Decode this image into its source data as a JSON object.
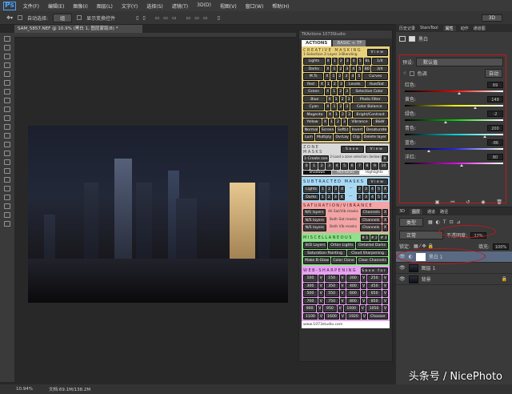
{
  "app": {
    "logo": "Ps",
    "menu": [
      "文件(F)",
      "编辑(E)",
      "图像(I)",
      "图层(L)",
      "文字(Y)",
      "选择(S)",
      "滤镜(T)",
      "3D(D)",
      "视图(V)",
      "窗口(W)",
      "帮助(H)"
    ]
  },
  "options": {
    "auto_select": "自动选择:",
    "auto_select_value": "组",
    "show_transform": "显示变换控件",
    "mode3d": "3D"
  },
  "document": {
    "tab": "SAM_5857.NEF @ 10.9% (黑白 1, 图层蒙版/8) *",
    "zoom": "10.94%",
    "doc_size": "文档:69.1M/138.2M"
  },
  "tk": {
    "title": "TKActions 1073Studio",
    "tabs": [
      "ACTIONS",
      "BASIC + TF"
    ],
    "creative": {
      "title": "CREATIVE MASKING",
      "subtitle": "1-Selection 2-Layer 3-Blending",
      "view": "View",
      "rows": [
        [
          "Lights",
          "X",
          "1",
          "2",
          "3",
          "4",
          "5",
          "BL",
          "1/4"
        ],
        [
          "Darks",
          "X",
          "1",
          "2",
          "3",
          "4",
          "5",
          "BD",
          "3/4"
        ],
        [
          "M.Ts",
          "X",
          "1",
          "2",
          "3",
          "4",
          "5",
          "Curves"
        ],
        [
          "Red",
          "X",
          "1",
          "2",
          "3",
          "Levels",
          "Hue/Sat"
        ],
        [
          "Green",
          "X",
          "1",
          "2",
          "3",
          "Selective Color"
        ],
        [
          "Blue",
          "X",
          "1",
          "2",
          "3",
          "Photo Filter"
        ],
        [
          "Cyan",
          "X",
          "1",
          "2",
          "3",
          "Color Balance"
        ],
        [
          "Magenta",
          "X",
          "1",
          "2",
          "3",
          "Bright/Contrast"
        ],
        [
          "Yellow",
          "X",
          "1",
          "2",
          "3",
          "Vibrance",
          "B&W"
        ],
        [
          "Normal",
          "Screen",
          "SoftLt",
          "Invert",
          "Desaturate"
        ],
        [
          "Lum",
          "Multiply",
          "OvrLay",
          "Clip",
          "Delete layer"
        ]
      ]
    },
    "zone": {
      "title": "ZONE MASKS",
      "save": "Save",
      "view": "View",
      "create": "1-Create zone masks",
      "load": "2-Load a zone selection (below)",
      "x": "X",
      "zones": [
        "0",
        "1",
        "2",
        "3",
        "4",
        "5",
        "6",
        "7",
        "8",
        "9",
        "10"
      ],
      "labels": [
        "Shadows",
        "Mid-tones",
        "Highlights"
      ]
    },
    "subtracted": {
      "title": "SUBTRACTED MASKS",
      "view": "View",
      "rows": [
        [
          "Lights",
          "1",
          "2",
          "3",
          "4",
          "—",
          "2",
          "3",
          "4",
          "5",
          "X"
        ],
        [
          "Darks",
          "1",
          "2",
          "3",
          "4",
          "—",
          "2",
          "3",
          "4",
          "5",
          "X"
        ]
      ]
    },
    "saturation": {
      "title": "SATURATION/VIBRANCE",
      "rows": [
        [
          "N/S layers",
          "All Sat/Vib masks",
          "Channels",
          "X"
        ],
        [
          "N/S layers",
          "Both Sat masks",
          "Channels",
          "X"
        ],
        [
          "N/S layers",
          "Both Vib masks",
          "Channels",
          "X"
        ]
      ]
    },
    "misc": {
      "title": "MISCELLANEOUS",
      "buttons": [
        "#1",
        "#2",
        "#3"
      ],
      "rows": [
        [
          "B/D Layers",
          "Orton Lights",
          "Detailed Darks"
        ],
        [
          "Saturation Painting",
          "Cloud Sharpening"
        ],
        [
          "Make B-Glow",
          "Color Clone",
          "Clear Channels"
        ]
      ]
    },
    "web": {
      "title": "WEB-SHARPENING",
      "save": "Save for Web",
      "rows": [
        [
          "100",
          "V",
          "150",
          "V",
          "200",
          "V",
          "250",
          "V"
        ],
        [
          "300",
          "V",
          "350",
          "V",
          "400",
          "V",
          "450",
          "V"
        ],
        [
          "500",
          "V",
          "550",
          "V",
          "600",
          "V",
          "650",
          "V"
        ],
        [
          "700",
          "V",
          "750",
          "V",
          "800",
          "V",
          "850",
          "V"
        ],
        [
          "900",
          "V",
          "950",
          "V",
          "1000",
          "V",
          "1050",
          "V"
        ],
        [
          "1100",
          "V",
          "1600",
          "V",
          "1920",
          "V",
          "Chooser"
        ]
      ]
    },
    "footer": "www.1073studio.com"
  },
  "properties": {
    "tabs": [
      "历史记录",
      "StarsTool",
      "属性",
      "动作",
      "通道图"
    ],
    "title": "黑白",
    "preset_label": "预设:",
    "preset": "默认值",
    "tint": "色调",
    "auto": "自动",
    "sliders": [
      {
        "label": "红色:",
        "value": 69,
        "g": "linear-gradient(90deg,#000,#e00 50%,#fff)"
      },
      {
        "label": "黄色:",
        "value": 149,
        "g": "linear-gradient(90deg,#000,#ee0 50%,#fff)"
      },
      {
        "label": "绿色:",
        "value": -2,
        "g": "linear-gradient(90deg,#000,#0c0 50%,#fff)"
      },
      {
        "label": "青色:",
        "value": 200,
        "g": "linear-gradient(90deg,#000,#0cc 50%,#fff)"
      },
      {
        "label": "蓝色:",
        "value": -86,
        "g": "linear-gradient(90deg,#000,#22e 50%,#fff)"
      },
      {
        "label": "洋红:",
        "value": 80,
        "g": "linear-gradient(90deg,#000,#d0d 50%,#fff)"
      }
    ]
  },
  "layers": {
    "tabs": [
      "3D",
      "图层",
      "通道",
      "路径"
    ],
    "filter": "类型",
    "blend": "正常",
    "opacity_label": "不透明度:",
    "opacity": "12%",
    "lock_label": "锁定:",
    "fill_label": "填充:",
    "fill": "100%",
    "items": [
      "黑白 1",
      "图层 1",
      "背景"
    ]
  },
  "watermark": "头条号 / NicePhoto",
  "colors": {
    "creative": "#e9d17c",
    "zone": "#d9d9d9",
    "subtracted": "#a9d9f2",
    "saturation": "#f3a5a5",
    "misc": "#90e08c",
    "web": "#e6a3ef",
    "highlight": "#c0181c"
  }
}
